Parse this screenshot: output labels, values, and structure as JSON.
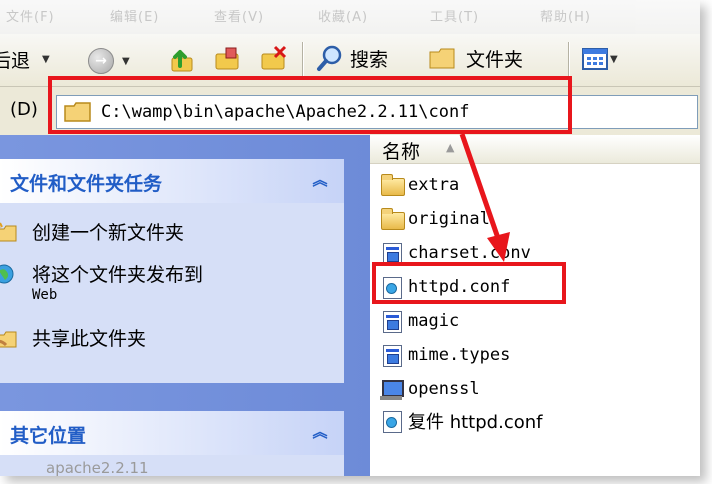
{
  "menubar": {
    "ghost_items": [
      "文件(F)",
      "编辑(E)",
      "查看(V)",
      "收藏(A)",
      "工具(T)",
      "帮助(H)"
    ]
  },
  "toolbar": {
    "back_label": "后退",
    "search_label": "搜索",
    "folders_label": "文件夹"
  },
  "address": {
    "label": "(D)",
    "path": "C:\\wamp\\bin\\apache\\Apache2.2.11\\conf"
  },
  "taskpane": {
    "file_tasks_title": "文件和文件夹任务",
    "tasks": [
      {
        "label": "创建一个新文件夹",
        "sub": ""
      },
      {
        "label": "将这个文件夹发布到",
        "sub": "Web"
      },
      {
        "label": "共享此文件夹",
        "sub": ""
      }
    ],
    "other_places_title": "其它位置",
    "other_places_item": "apache2.2.11"
  },
  "filelist": {
    "column_name": "名称",
    "files": [
      {
        "name": "extra",
        "icon": "folder-icon"
      },
      {
        "name": "original",
        "icon": "folder-icon"
      },
      {
        "name": "charset.conv",
        "icon": "system-file-icon"
      },
      {
        "name": "httpd.conf",
        "icon": "config-file-icon"
      },
      {
        "name": "magic",
        "icon": "system-file-icon"
      },
      {
        "name": "mime.types",
        "icon": "system-file-icon"
      },
      {
        "name": "openssl",
        "icon": "application-icon"
      },
      {
        "name": "复件 httpd.conf",
        "icon": "config-file-icon"
      }
    ]
  },
  "colors": {
    "highlight_red": "#e8161c",
    "xp_blue": "#215dc6"
  }
}
